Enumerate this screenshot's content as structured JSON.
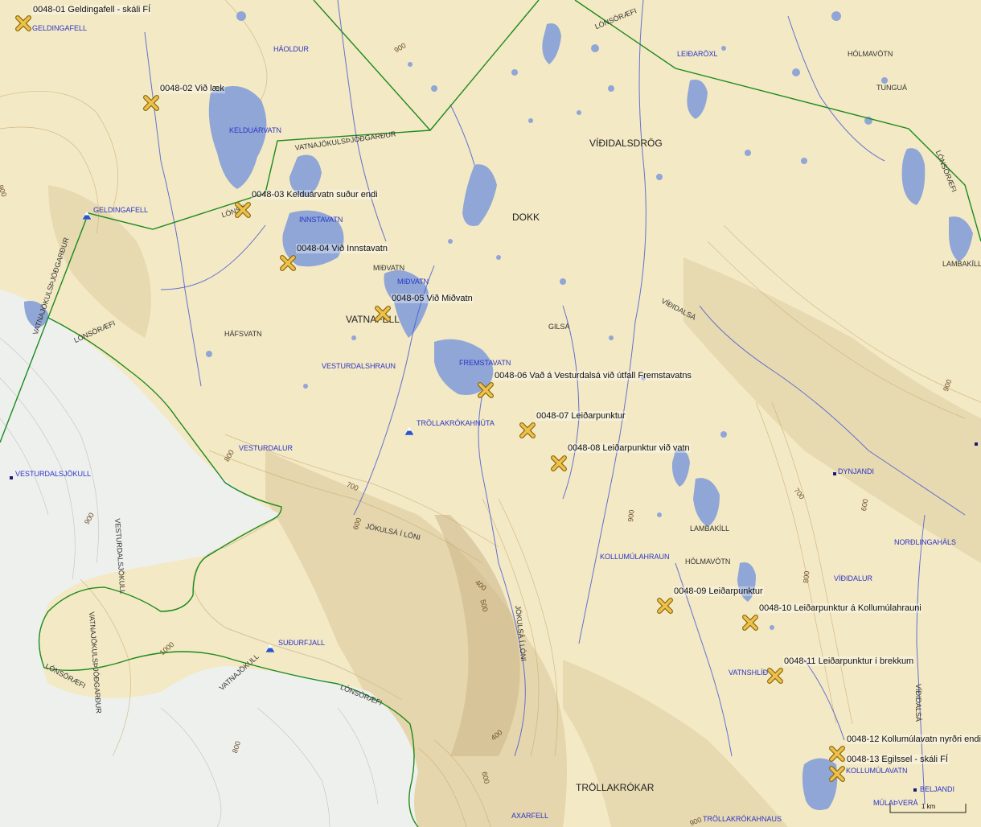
{
  "waypoints": [
    {
      "label": "0048-01 Geldingafell - skáli FÍ"
    },
    {
      "label": "0048-02 Við læk"
    },
    {
      "label": "0048-03 Kelduárvatn suður endi"
    },
    {
      "label": "0048-04 Við Innstavatn"
    },
    {
      "label": "0048-05 Við Miðvatn"
    },
    {
      "label": "0048-06 Vað á Vesturdalsá við útfall Fremstavatns"
    },
    {
      "label": "0048-07 Leiðarpunktur"
    },
    {
      "label": "0048-08 Leiðarpunktur við vatn"
    },
    {
      "label": "0048-09 Leiðarpunktur"
    },
    {
      "label": "0048-10 Leiðarpunktur á Kollumúlahrauni"
    },
    {
      "label": "0048-11 Leiðarpunktur í brekkum"
    },
    {
      "label": "0048-12 Kollumúlavatn nyrðri endi"
    },
    {
      "label": "0048-13 Egilssel - skáli FÍ"
    }
  ],
  "blue_labels": {
    "geldingafell_top": "GELDINGAFELL",
    "haoldur": "HÁOLDUR",
    "kelduarvatn": "KELDUÁRVATN",
    "leidaroxl": "LEIÐARÖXL",
    "geldingafell": "GELDINGAFELL",
    "innstavatn": "INNSTAVATN",
    "midvatn": "MIÐVATN",
    "vesturdalshraun": "VESTURDALSHRAUN",
    "fremstavatn": "FREMSTAVATN",
    "trollakrokahnuta": "TRÖLLAKRÓKAHNÚTA",
    "vesturdalur": "VESTURDALUR",
    "vesturdalsjokull": "VESTURDALSJÖKULL",
    "dynjandi": "DYNJANDI",
    "nordlingahals": "NORÐLINGAHÁLS",
    "kollumulahraun": "KOLLUMÚLAHRAUN",
    "vididalur": "VÍÐIDALUR",
    "sudurfjall": "SUÐURFJALL",
    "vatnshlid": "VATNSHLÍÐ",
    "kollumulavatn": "KOLLUMÚLAVATN",
    "beljandi": "BELJANDI",
    "mulapvera": "MÚLAÞVERÁ",
    "axarfell": "AXARFELL",
    "trollakrokahnaus": "TRÖLLAKRÓKAHNAUS"
  },
  "dark_labels": {
    "vididalsdrog": "VÍÐIDALSDRÖG",
    "dokk": "DOKK",
    "vatnafell": "VATNAFELL",
    "trollakrokar": "TRÖLLAKRÓKAR"
  },
  "small_labels": {
    "holmavotn_top": "HÓLMAVÖTN",
    "tungua": "TUNGUÁ",
    "lambakill_right": "LAMBAKÍLL",
    "midvatn_lake": "MIÐVATN",
    "hafsvatn": "HÁFSVATN",
    "gilsa": "GILSÁ",
    "lambakill": "LAMBAKÍLL",
    "holmavotn": "HÓLMAVÖTN"
  },
  "rotated_labels": {
    "lonsoraefi_top": "LÓNSÖRÆFI",
    "lonsoraefi_right": "LÓNSÖRÆFI",
    "vatnajokulsthjodgardur_top": "VATNAJÖKULSÞJÓÐGARÐUR",
    "lonso": "LÓNSÖ",
    "vatnajokulsthjodgardur_left": "VATNAJÖKULSÞJÓÐGARÐUR",
    "lonsoraefi_left": "LÓNSÖRÆFI",
    "vididalsa": "VÍÐIDALSÁ",
    "jokulsa_i_loni": "JÖKULSÁ Í LÓNI",
    "jokulsa_i_loni_v": "JÖKULSÁ Í LÓNI",
    "vesturdalsjokull_v": "VESTURDALSJÖKULL",
    "vatnajokulsthjodgardur_lower": "VATNAJÖKULSÞJÓÐGARÐUR",
    "lonsoraefi_lower_left": "LÓNSÖRÆFI",
    "vatnajokull": "VATNAJÖKULL",
    "lonsoraefi_lower": "LÓNSÖRÆFI",
    "vididalsa_v": "VÍÐIDALSÁ"
  },
  "contour_labels": [
    "900",
    "900",
    "800",
    "700",
    "600",
    "900",
    "700",
    "600",
    "800",
    "900",
    "400",
    "500",
    "1000",
    "400",
    "600",
    "900",
    "800",
    "900"
  ],
  "scale_bar": "1 km",
  "colors": {
    "land": "#f3e9c4",
    "ice": "#eef0ee",
    "water": "#8fa6d6",
    "boundary": "#1c8a1c",
    "waypoint": "#e8b53a"
  },
  "icons": [
    "waypoint-cross-icon",
    "mountain-hut-icon",
    "summit-dot-icon"
  ]
}
